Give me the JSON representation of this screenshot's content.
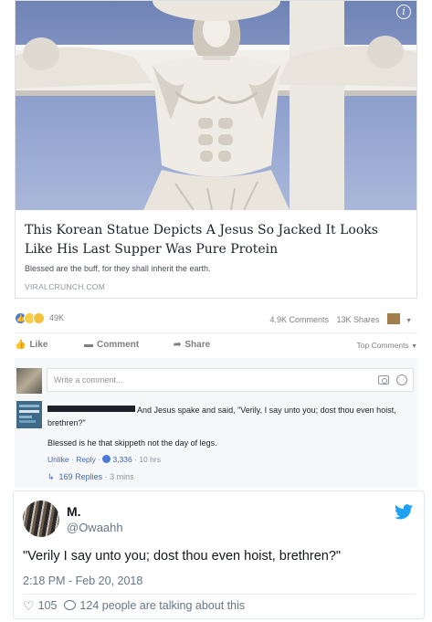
{
  "facebook": {
    "link": {
      "title": "This Korean Statue Depicts A Jesus So Jacked It Looks Like His Last Supper Was Pure Protein",
      "description": "Blessed are the buff, for they shall inherit the earth.",
      "domain": "VIRALCRUNCH.COM",
      "image_icon": "info-icon"
    },
    "reactions": {
      "count": "49K",
      "comments": "4.9K Comments",
      "shares": "13K Shares"
    },
    "actions": {
      "like": "Like",
      "comment": "Comment",
      "share": "Share",
      "top_comments": "Top Comments"
    },
    "write_comment_placeholder": "Write a comment...",
    "comment": {
      "text": "And Jesus spake and said, \"Verily, I say unto you; dost thou even hoist, brethren?\""
    },
    "reply": {
      "text": "Blessed is he that skippeth not the day of legs.",
      "unlike": "Unlike",
      "reply": "Reply",
      "likes": "3,336",
      "time": "10 hrs"
    },
    "replies": {
      "label": "169 Replies",
      "time": "3 mins"
    }
  },
  "tweet": {
    "name": "M.",
    "handle": "@Owaahh",
    "text": "\"Verily I say unto you; dost thou even hoist, brethren?\"",
    "timestamp": "2:18 PM - Feb 20, 2018",
    "likes": "105",
    "talking": "124 people are talking about this",
    "accent": "#1da1f2"
  }
}
